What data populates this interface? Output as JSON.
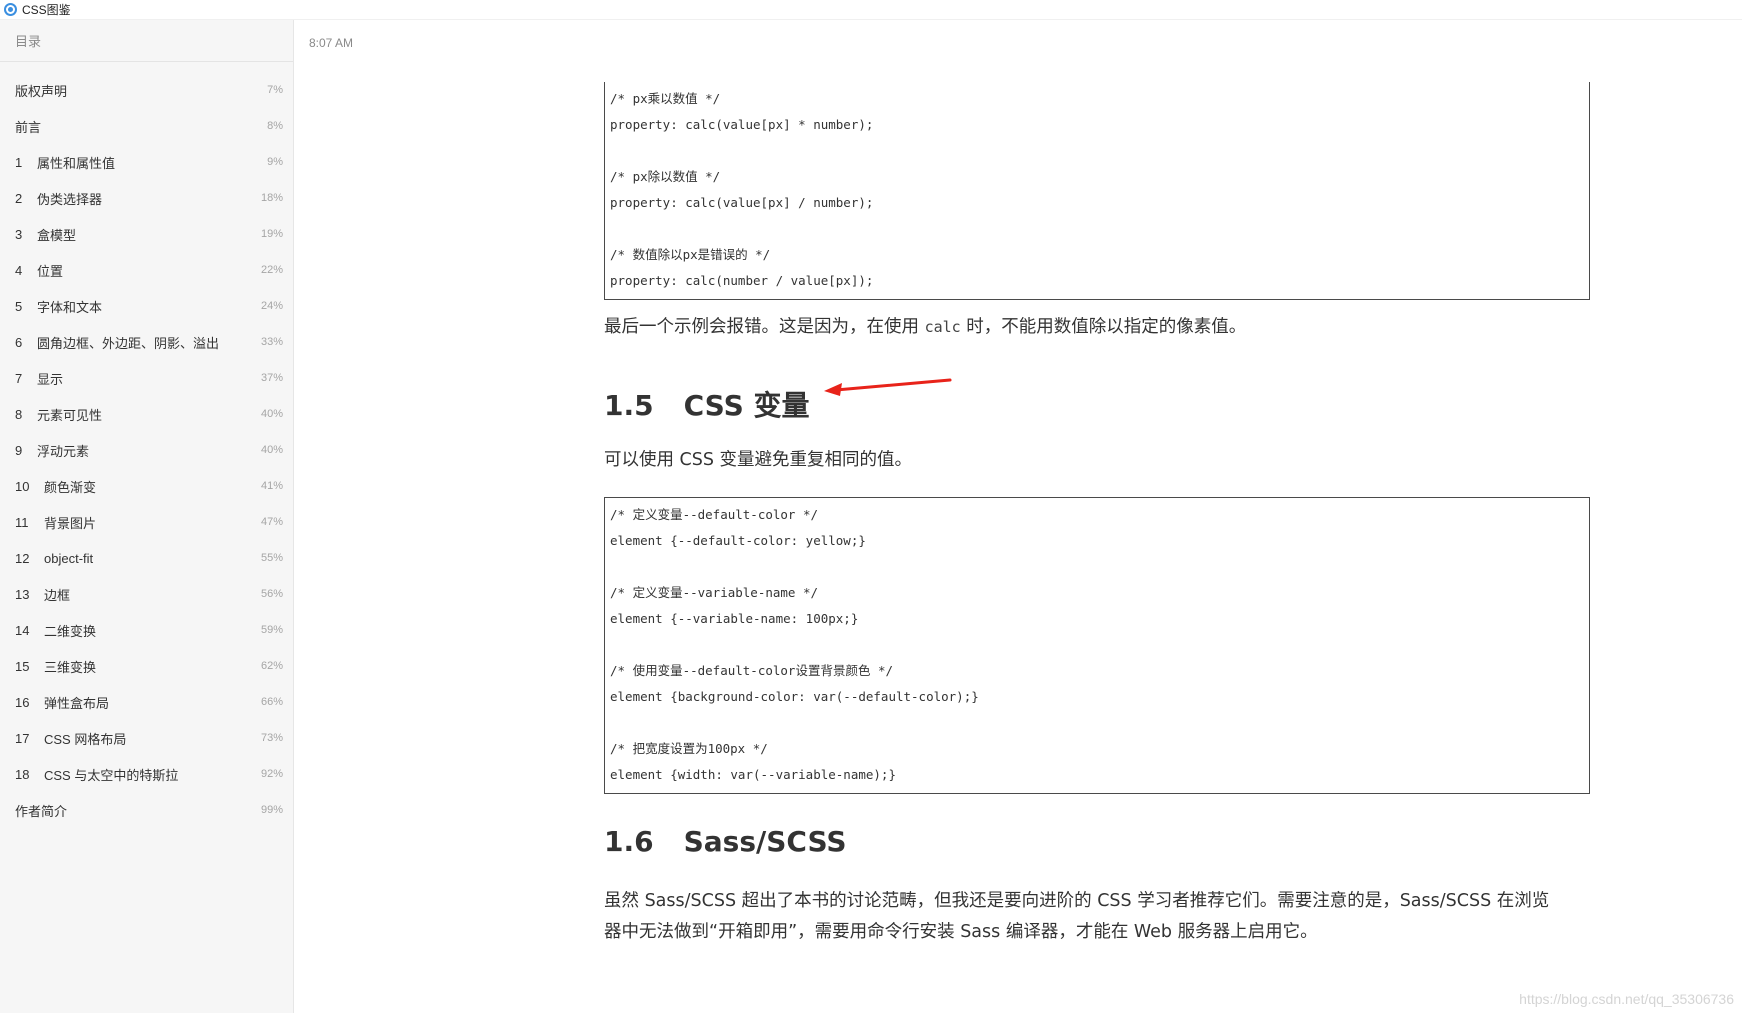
{
  "window": {
    "title": "CSS图鉴"
  },
  "sidebar": {
    "header": "目录",
    "items": [
      {
        "num": "",
        "label": "版权声明",
        "pct": "7%"
      },
      {
        "num": "",
        "label": "前言",
        "pct": "8%"
      },
      {
        "num": "1",
        "label": "属性和属性值",
        "pct": "9%"
      },
      {
        "num": "2",
        "label": "伪类选择器",
        "pct": "18%"
      },
      {
        "num": "3",
        "label": "盒模型",
        "pct": "19%"
      },
      {
        "num": "4",
        "label": "位置",
        "pct": "22%"
      },
      {
        "num": "5",
        "label": "字体和文本",
        "pct": "24%"
      },
      {
        "num": "6",
        "label": "圆角边框、外边距、阴影、溢出",
        "pct": "33%"
      },
      {
        "num": "7",
        "label": "显示",
        "pct": "37%"
      },
      {
        "num": "8",
        "label": "元素可见性",
        "pct": "40%"
      },
      {
        "num": "9",
        "label": "浮动元素",
        "pct": "40%"
      },
      {
        "num": "10",
        "label": "颜色渐变",
        "pct": "41%"
      },
      {
        "num": "11",
        "label": "背景图片",
        "pct": "47%"
      },
      {
        "num": "12",
        "label": "object-fit",
        "pct": "55%"
      },
      {
        "num": "13",
        "label": "边框",
        "pct": "56%"
      },
      {
        "num": "14",
        "label": "二维变换",
        "pct": "59%"
      },
      {
        "num": "15",
        "label": "三维变换",
        "pct": "62%"
      },
      {
        "num": "16",
        "label": "弹性盒布局",
        "pct": "66%"
      },
      {
        "num": "17",
        "label": "CSS 网格布局",
        "pct": "73%"
      },
      {
        "num": "18",
        "label": "CSS 与太空中的特斯拉",
        "pct": "92%"
      },
      {
        "num": "",
        "label": "作者简介",
        "pct": "99%"
      }
    ]
  },
  "main": {
    "timestamp": "8:07 AM",
    "code1": [
      "/* px乘以数值 */",
      "property: calc(value[px] * number);",
      "",
      "/* px除以数值 */",
      "property: calc(value[px] / number);",
      "",
      "/* 数值除以px是错误的 */",
      "property: calc(number / value[px]);"
    ],
    "para1_before": "最后一个示例会报错。这是因为，在使用 ",
    "para1_code": "calc",
    "para1_after": " 时，不能用数值除以指定的像素值。",
    "heading1_num": "1.5",
    "heading1_title": "CSS 变量",
    "para2": "可以使用 CSS 变量避免重复相同的值。",
    "code2": [
      "/* 定义变量--default-color */",
      "element {--default-color: yellow;}",
      "",
      "/* 定义变量--variable-name */",
      "element {--variable-name: 100px;}",
      "",
      "/* 使用变量--default-color设置背景颜色 */",
      "element {background-color: var(--default-color);}",
      "",
      "/* 把宽度设置为100px */",
      "element {width: var(--variable-name);}"
    ],
    "heading2_num": "1.6",
    "heading2_title": "Sass/SCSS",
    "para3_line1": "虽然 Sass/SCSS 超出了本书的讨论范畴，但我还是要向进阶的 CSS 学习者推荐它们。需要注意的是，Sass/SCSS 在浏览",
    "para3_line2": "器中无法做到“开箱即用”，需要用命令行安装 Sass 编译器，才能在 Web 服务器上启用它。"
  },
  "watermark": "https://blog.csdn.net/qq_35306736",
  "colors": {
    "arrow": "#e8231a",
    "sidebar_bg": "#f6f6f6",
    "code_border": "#4a4a4a"
  }
}
